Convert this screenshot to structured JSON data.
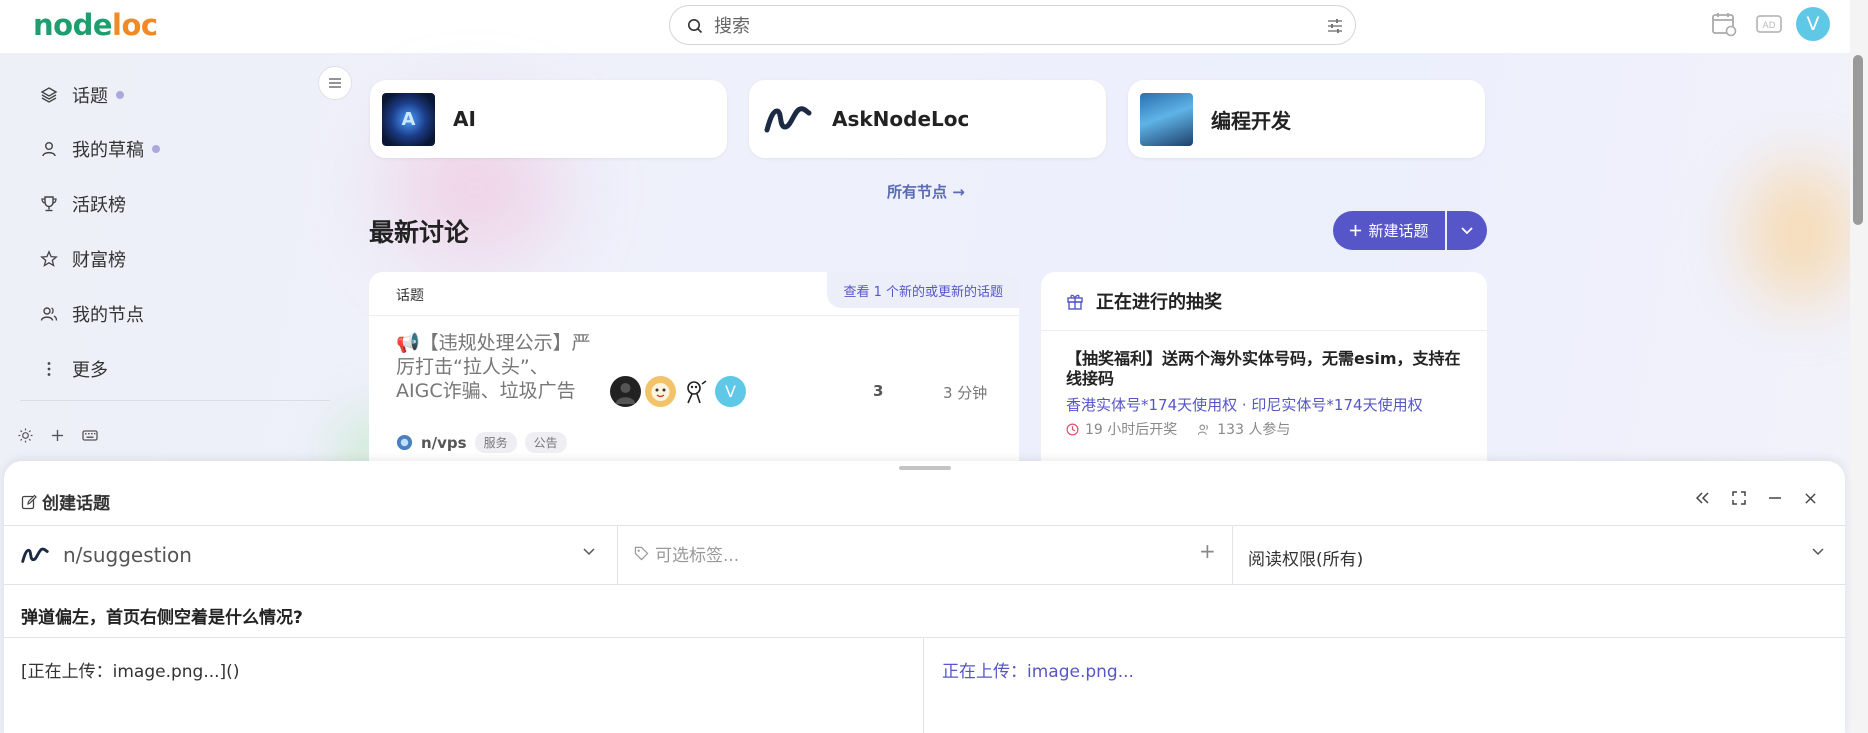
{
  "header": {
    "logo_part1": "node",
    "logo_part2": "loc",
    "search_placeholder": "搜索",
    "avatar_letter": "V"
  },
  "sidebar": {
    "items": [
      {
        "label": "话题",
        "icon": "layers-icon"
      },
      {
        "label": "我的草稿",
        "icon": "user-icon"
      },
      {
        "label": "活跃榜",
        "icon": "trophy-icon"
      },
      {
        "label": "财富榜",
        "icon": "star-icon"
      },
      {
        "label": "我的节点",
        "icon": "users-icon"
      },
      {
        "label": "更多",
        "icon": "more-vertical-icon"
      }
    ]
  },
  "categories": [
    {
      "label": "AI"
    },
    {
      "label": "AskNodeLoc"
    },
    {
      "label": "编程开发"
    }
  ],
  "all_nodes_link": "所有节点 →",
  "section_title": "最新讨论",
  "new_topic_button": "新建话题",
  "topic_list": {
    "column_header": "话题",
    "new_link": "查看 1 个新的或更新的话题",
    "topics": [
      {
        "emoji": "📢",
        "title": "【违规处理公示】严厉打击“拉人头”、AIGC诈骗、垃圾广告",
        "node": "n/vps",
        "tags": [
          "服务",
          "公告"
        ],
        "poster_letter": "V",
        "replies": "3",
        "activity": "3 分钟"
      }
    ]
  },
  "lottery": {
    "heading": "正在进行的抽奖",
    "title": "【抽奖福利】送两个海外实体号码，无需esim，支持在线接码",
    "prizes": "香港实体号*174天使用权 · 印尼实体号*174天使用权",
    "time_left": "19 小时后开奖",
    "participants": "133 人参与"
  },
  "composer": {
    "title": "创建话题",
    "category": "n/suggestion",
    "tags_placeholder": "可选标签...",
    "permission": "阅读权限(所有)",
    "subject": "弹道偏左，首页右侧空着是什么情况?",
    "body": "[正在上传：image.png...]()",
    "preview": "正在上传：image.png..."
  },
  "colors": {
    "accent": "#5656c8",
    "logo_green": "#1e9e6e",
    "logo_orange": "#f08a24",
    "avatar": "#5ec8e6"
  }
}
